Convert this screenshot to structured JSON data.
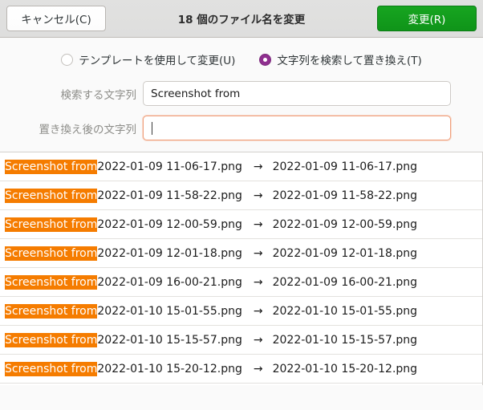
{
  "header": {
    "cancel_label": "キャンセル(C)",
    "title": "18 個のファイル名を変更",
    "rename_label": "変更(R)"
  },
  "mode_options": {
    "template": {
      "label": "テンプレートを使用して変更(U)",
      "selected": false
    },
    "find_replace": {
      "label": "文字列を検索して置き換え(T)",
      "selected": true
    }
  },
  "form": {
    "search_label": "検索する文字列",
    "search_value": "Screenshot from",
    "replace_label": "置き換え後の文字列",
    "replace_value": ""
  },
  "colors": {
    "suggested_button": "#17a520",
    "radio_selected": "#8f2f8f",
    "match_highlight": "#f57c00",
    "entry_focus_border": "#f0a07c",
    "headerbar_bg": "#e1e1e0"
  },
  "file_list": {
    "match_text": "Screenshot from",
    "arrow": "→",
    "rows": [
      {
        "old_rest": "2022-01-09 11-06-17.png",
        "new_name": "2022-01-09 11-06-17.png"
      },
      {
        "old_rest": "2022-01-09 11-58-22.png",
        "new_name": "2022-01-09 11-58-22.png"
      },
      {
        "old_rest": "2022-01-09 12-00-59.png",
        "new_name": "2022-01-09 12-00-59.png"
      },
      {
        "old_rest": "2022-01-09 12-01-18.png",
        "new_name": "2022-01-09 12-01-18.png"
      },
      {
        "old_rest": "2022-01-09 16-00-21.png",
        "new_name": "2022-01-09 16-00-21.png"
      },
      {
        "old_rest": "2022-01-10 15-01-55.png",
        "new_name": "2022-01-10 15-01-55.png"
      },
      {
        "old_rest": "2022-01-10 15-15-57.png",
        "new_name": "2022-01-10 15-15-57.png"
      },
      {
        "old_rest": "2022-01-10 15-20-12.png",
        "new_name": "2022-01-10 15-20-12.png"
      }
    ]
  }
}
